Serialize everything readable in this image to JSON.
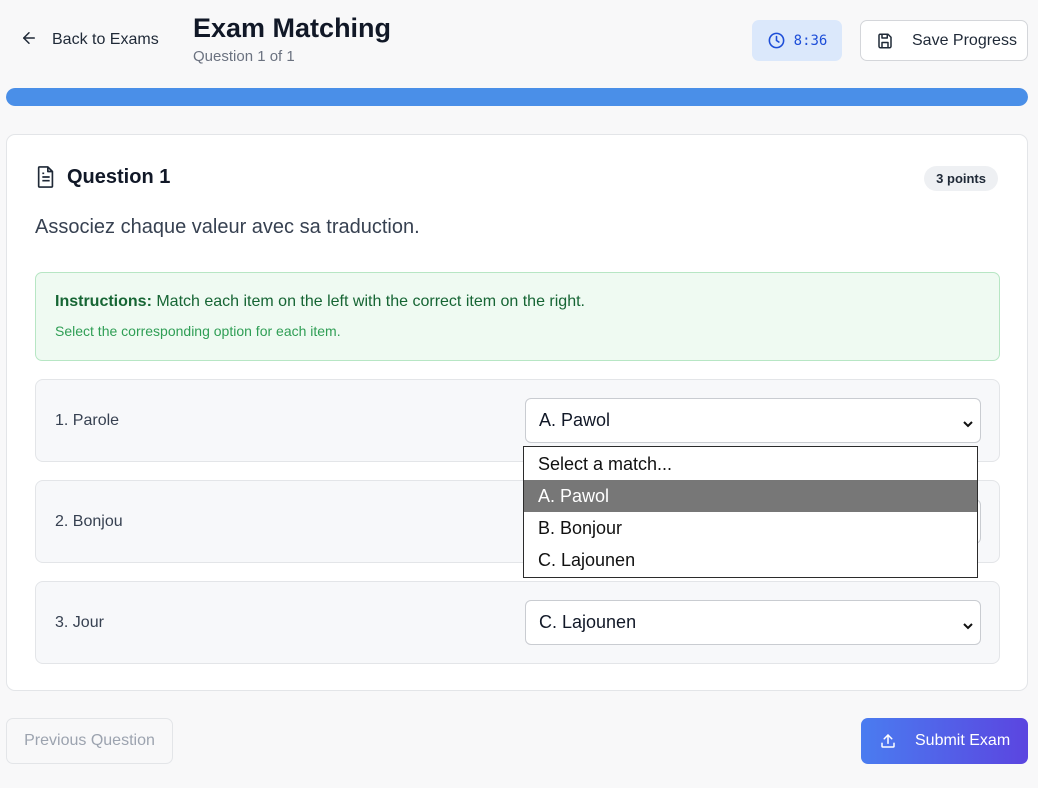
{
  "header": {
    "back_label": "Back to Exams",
    "title": "Exam Matching",
    "subtitle": "Question 1 of 1",
    "timer": "8:36",
    "save_label": "Save Progress"
  },
  "progress": {
    "percent": 100
  },
  "question": {
    "title": "Question 1",
    "points": "3 points",
    "prompt": "Associez chaque valeur avec sa traduction.",
    "instructions_bold": "Instructions:",
    "instructions_text": " Match each item on the left with the correct item on the right.",
    "instructions_hint": "Select the corresponding option for each item."
  },
  "matches": [
    {
      "label": "1. Parole",
      "selected": "A. Pawol"
    },
    {
      "label": "2. Bonjou",
      "selected": ""
    },
    {
      "label": "3. Jour",
      "selected": "C. Lajounen"
    }
  ],
  "dropdown": {
    "options": [
      "Select a match...",
      "A. Pawol",
      "B. Bonjour",
      "C. Lajounen"
    ],
    "highlighted": "A. Pawol"
  },
  "footer": {
    "prev_label": "Previous Question",
    "submit_label": "Submit Exam"
  },
  "colors": {
    "accent": "#4a8fe8",
    "timer_bg": "#dbe8fb",
    "instructions_bg": "#effaf2",
    "submit_gradient_start": "#4a7cf0",
    "submit_gradient_end": "#5b45e0"
  }
}
